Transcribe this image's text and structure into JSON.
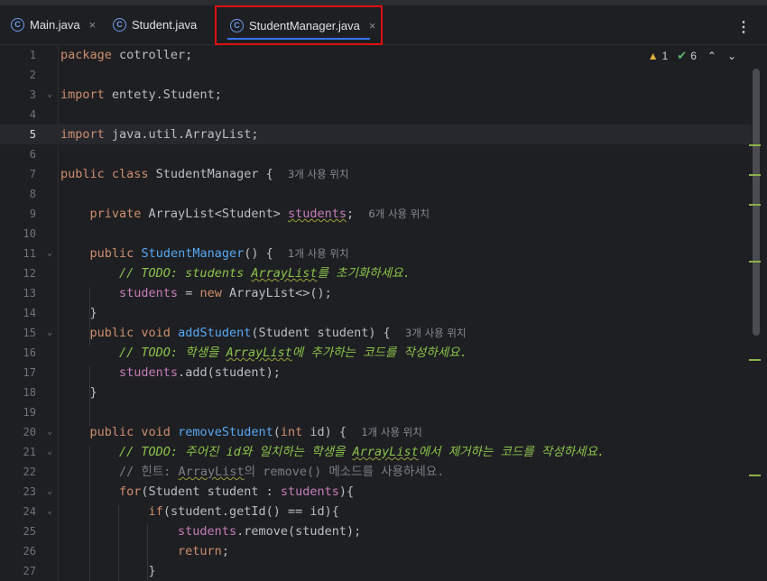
{
  "tabs": [
    {
      "label": "Main.java",
      "icon": "class-c-icon",
      "close": "×"
    },
    {
      "label": "Student.java",
      "icon": "class-c-icon"
    },
    {
      "label": "StudentManager.java",
      "icon": "class-c-icon",
      "close": "×",
      "active": true
    }
  ],
  "more_icon": "⋮",
  "inspections": {
    "warnings": "1",
    "ok": "6"
  },
  "line_numbers": [
    "1",
    "2",
    "3",
    "4",
    "5",
    "6",
    "7",
    "8",
    "9",
    "10",
    "11",
    "12",
    "13",
    "14",
    "15",
    "16",
    "17",
    "18",
    "19",
    "20",
    "21",
    "22",
    "23",
    "24",
    "25",
    "26",
    "27"
  ],
  "code": {
    "l1_kw": "package",
    "l1_rest": " cotroller;",
    "l3_kw": "import",
    "l3_rest": " entety.Student;",
    "l5_kw": "import",
    "l5_rest": " java.util.ArrayList;",
    "l7_kw": "public class",
    "l7_rest": " StudentManager {",
    "l7_hint": "3개 사용 위치",
    "l9_kw": "private",
    "l9_type": " ArrayList<Student> ",
    "l9_field": "students",
    "l9_end": ";",
    "l9_hint": "6개 사용 위치",
    "l11_kw": "public",
    "l11_fn": "StudentManager",
    "l11_rest": "() {",
    "l11_hint": "1개 사용 위치",
    "l12_a": "// TODO: students ",
    "l12_sq": "ArrayList",
    "l12_b": "를 초기화하세요.",
    "l13_field": "students",
    "l13_eq": " = ",
    "l13_kw": "new",
    "l13_rest": " ArrayList<>();",
    "l14": "}",
    "l15_kw": "public void",
    "l15_fn": "addStudent",
    "l15_rest": "(Student student) {",
    "l15_hint": "3개 사용 위치",
    "l16_a": "// TODO: 학생을 ",
    "l16_sq": "ArrayList",
    "l16_b": "에 추가하는 코드를 작성하세요.",
    "l17_field": "students",
    "l17_rest": ".add(student);",
    "l18": "}",
    "l20_kw": "public void",
    "l20_fn": "removeStudent",
    "l20_p1": "(",
    "l20_int": "int",
    "l20_rest": " id) {",
    "l20_hint": "1개 사용 위치",
    "l21_a": "// TODO: 주어진 id와 일치하는 학생을 ",
    "l21_sq": "ArrayList",
    "l21_b": "에서 제거하는 코드를 작성하세요.",
    "l22_a": "// 힌트: ",
    "l22_sq": "ArrayList",
    "l22_b": "의 remove() 메소드를 사용하세요.",
    "l23_kw": "for",
    "l23_rest": "(Student student : ",
    "l23_field": "students",
    "l23_end": "){",
    "l24_kw": "if",
    "l24_rest": "(student.getId() == id){",
    "l25_field": "students",
    "l25_rest": ".remove(student);",
    "l26_kw": "return",
    "l26_rest": ";",
    "l27": "}"
  }
}
